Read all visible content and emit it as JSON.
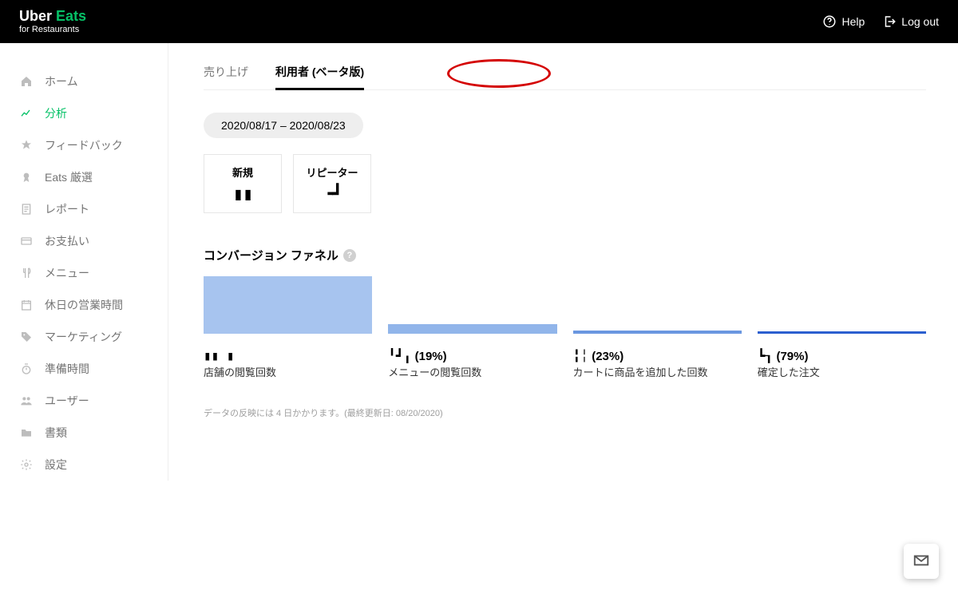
{
  "header": {
    "logo_brand": "Uber",
    "logo_eats": "Eats",
    "logo_sub": "for Restaurants",
    "help": "Help",
    "logout": "Log out"
  },
  "sidebar": {
    "items": [
      {
        "label": "ホーム",
        "icon": "home"
      },
      {
        "label": "分析",
        "icon": "chart"
      },
      {
        "label": "フィードバック",
        "icon": "star"
      },
      {
        "label": "Eats 厳選",
        "icon": "medal"
      },
      {
        "label": "レポート",
        "icon": "doc"
      },
      {
        "label": "お支払い",
        "icon": "card"
      },
      {
        "label": "メニュー",
        "icon": "fork"
      },
      {
        "label": "休日の営業時間",
        "icon": "calendar"
      },
      {
        "label": "マーケティング",
        "icon": "tag"
      },
      {
        "label": "準備時間",
        "icon": "timer"
      },
      {
        "label": "ユーザー",
        "icon": "users"
      },
      {
        "label": "書類",
        "icon": "folder"
      },
      {
        "label": "設定",
        "icon": "gear"
      }
    ],
    "active_index": 1
  },
  "tabs": {
    "items": [
      {
        "label": "売り上げ"
      },
      {
        "label": "利用者 (ベータ版)"
      }
    ],
    "active_index": 1
  },
  "date_range": "2020/08/17 – 2020/08/23",
  "cards": [
    {
      "title": "新規",
      "value": "▮▮"
    },
    {
      "title": "リピーター",
      "value": "╺┛"
    }
  ],
  "funnel": {
    "title": "コンバージョン ファネル",
    "cols": [
      {
        "value": "▮▮ ▮",
        "pct": "",
        "label": "店舗の閲覧回数"
      },
      {
        "value": "╹┛╻",
        "pct": "(19%)",
        "label": "メニューの閲覧回数"
      },
      {
        "value": "╏╎",
        "pct": "(23%)",
        "label": "カートに商品を追加した回数"
      },
      {
        "value": "┗┒",
        "pct": "(79%)",
        "label": "確定した注文"
      }
    ]
  },
  "note": "データの反映には 4 日かかります。(最終更新日: 08/20/2020)",
  "colors": {
    "accent": "#06c167"
  }
}
